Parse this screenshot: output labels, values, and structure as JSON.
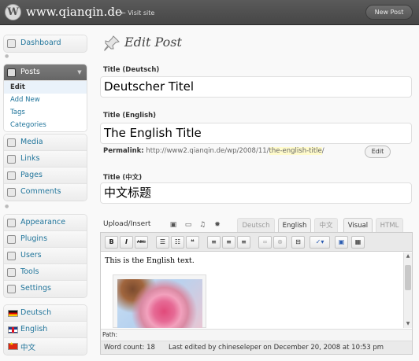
{
  "header": {
    "site_title": "www.qianqin.de",
    "visit_site": "← Visit site",
    "new_post": "New Post"
  },
  "sidebar": {
    "dashboard": "Dashboard",
    "posts": "Posts",
    "posts_sub": [
      "Edit",
      "Add New",
      "Tags",
      "Categories"
    ],
    "group2": [
      "Media",
      "Links",
      "Pages",
      "Comments"
    ],
    "group3": [
      "Appearance",
      "Plugins",
      "Users",
      "Tools",
      "Settings"
    ],
    "languages": [
      "Deutsch",
      "English",
      "中文"
    ]
  },
  "main": {
    "page_title": "Edit Post",
    "title_de_label": "Title (Deutsch)",
    "title_de_value": "Deutscher Titel",
    "title_en_label": "Title (English)",
    "title_en_value": "The English Title",
    "permalink_label": "Permalink:",
    "permalink_base": "http://www2.qianqin.de/wp/2008/11/",
    "permalink_slug": "the-english-title",
    "permalink_trail": "/",
    "permalink_edit": "Edit",
    "title_zh_label": "Title (中文)",
    "title_zh_value": "中文标题"
  },
  "editor": {
    "upload_label": "Upload/Insert",
    "lang_tabs": [
      "Deutsch",
      "English",
      "中文"
    ],
    "mode_tabs": [
      "Visual",
      "HTML"
    ],
    "toolbar": [
      "B",
      "I",
      "ABC"
    ],
    "content": "This is the English text.",
    "path_label": "Path:",
    "word_count": "Word count: 18",
    "last_edited": "Last edited by chineseleper on December 20, 2008 at 10:53 pm"
  },
  "colors": {
    "link": "#21759b",
    "header_bg": "#464646",
    "active_menu_bg": "#6d6d6d",
    "permalink_highlight": "#fffbcc"
  }
}
